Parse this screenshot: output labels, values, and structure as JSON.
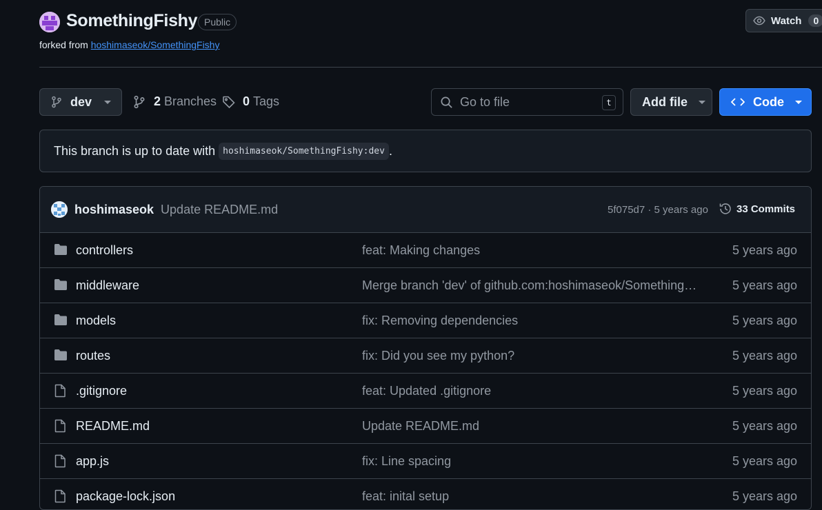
{
  "repo": {
    "name": "SomethingFishy",
    "visibility": "Public",
    "forked_prefix": "forked from",
    "forked_from": "hoshimaseok/SomethingFishy"
  },
  "watch": {
    "label": "Watch",
    "count": "0"
  },
  "toolbar": {
    "branch": "dev",
    "branches_count": "2",
    "branches_label": "Branches",
    "tags_count": "0",
    "tags_label": "Tags",
    "search_placeholder": "Go to file",
    "search_shortcut": "t",
    "add_file": "Add file",
    "code": "Code"
  },
  "status": {
    "text": "This branch is up to date with",
    "ref": "hoshimaseok/SomethingFishy:dev",
    "suffix": "."
  },
  "latest_commit": {
    "author": "hoshimaseok",
    "message": "Update README.md",
    "sha_time": "5f075d7 · 5 years ago",
    "commits_label": "33 Commits"
  },
  "files": [
    {
      "name": "controllers",
      "type": "folder",
      "message": "feat: Making changes",
      "date": "5 years ago"
    },
    {
      "name": "middleware",
      "type": "folder",
      "message": "Merge branch 'dev' of github.com:hoshimaseok/SomethingF…",
      "date": "5 years ago"
    },
    {
      "name": "models",
      "type": "folder",
      "message": "fix: Removing dependencies",
      "date": "5 years ago"
    },
    {
      "name": "routes",
      "type": "folder",
      "message": "fix: Did you see my python?",
      "date": "5 years ago"
    },
    {
      "name": ".gitignore",
      "type": "file",
      "message": "feat: Updated .gitignore",
      "date": "5 years ago"
    },
    {
      "name": "README.md",
      "type": "file",
      "message": "Update README.md",
      "date": "5 years ago"
    },
    {
      "name": "app.js",
      "type": "file",
      "message": "fix: Line spacing",
      "date": "5 years ago"
    },
    {
      "name": "package-lock.json",
      "type": "file",
      "message": "feat: inital setup",
      "date": "5 years ago"
    }
  ],
  "colors": {
    "background": "#0d1117",
    "border": "#3d444d",
    "accent": "#1f6feb",
    "link": "#4493f8",
    "muted": "#9198a1"
  }
}
